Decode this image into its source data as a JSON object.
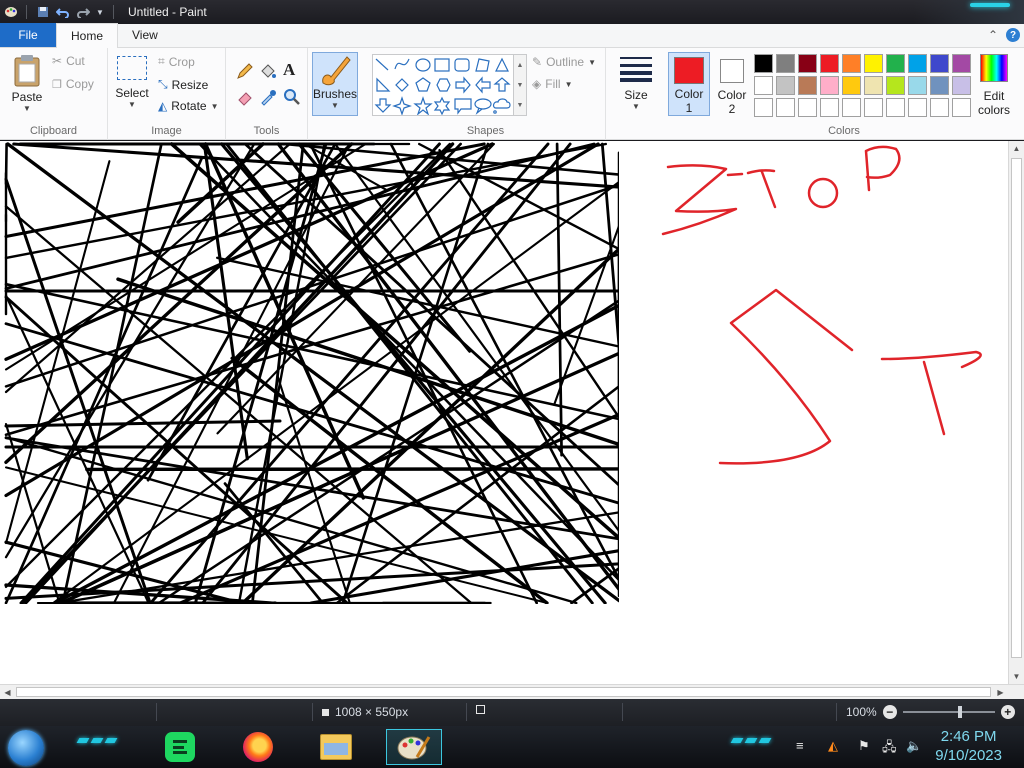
{
  "window": {
    "title": "Untitled - Paint"
  },
  "tabs": {
    "file": "File",
    "home": "Home",
    "view": "View"
  },
  "clipboard": {
    "paste": "Paste",
    "cut": "Cut",
    "copy": "Copy",
    "label": "Clipboard"
  },
  "image": {
    "select": "Select",
    "crop": "Crop",
    "resize": "Resize",
    "rotate": "Rotate",
    "label": "Image"
  },
  "tools": {
    "label": "Tools"
  },
  "brushes": {
    "label": "Brushes"
  },
  "shapes": {
    "outline": "Outline",
    "fill": "Fill",
    "label": "Shapes"
  },
  "size": {
    "label": "Size"
  },
  "colors": {
    "color1_label": "Color",
    "color1_num": "1",
    "color2_label": "Color",
    "color2_num": "2",
    "edit_label": "Edit",
    "edit_label2": "colors",
    "label": "Colors",
    "color1": "#ed1c24",
    "color2": "#ffffff",
    "palette_row1": [
      "#000000",
      "#7f7f7f",
      "#880015",
      "#ed1c24",
      "#ff7f27",
      "#fff200",
      "#22b14c",
      "#00a2e8",
      "#3f48cc",
      "#a349a4"
    ],
    "palette_row2": [
      "#ffffff",
      "#c3c3c3",
      "#b97a57",
      "#ffaec9",
      "#ffc90e",
      "#efe4b0",
      "#b5e61d",
      "#99d9ea",
      "#7092be",
      "#c8bfe7"
    ],
    "palette_row3": [
      "#ffffff",
      "#ffffff",
      "#ffffff",
      "#ffffff",
      "#ffffff",
      "#ffffff",
      "#ffffff",
      "#ffffff",
      "#ffffff",
      "#ffffff"
    ]
  },
  "status": {
    "dimensions": "1008 × 550px",
    "zoom": "100%"
  },
  "taskbar": {
    "time": "2:46 PM",
    "date": "9/10/2023"
  }
}
